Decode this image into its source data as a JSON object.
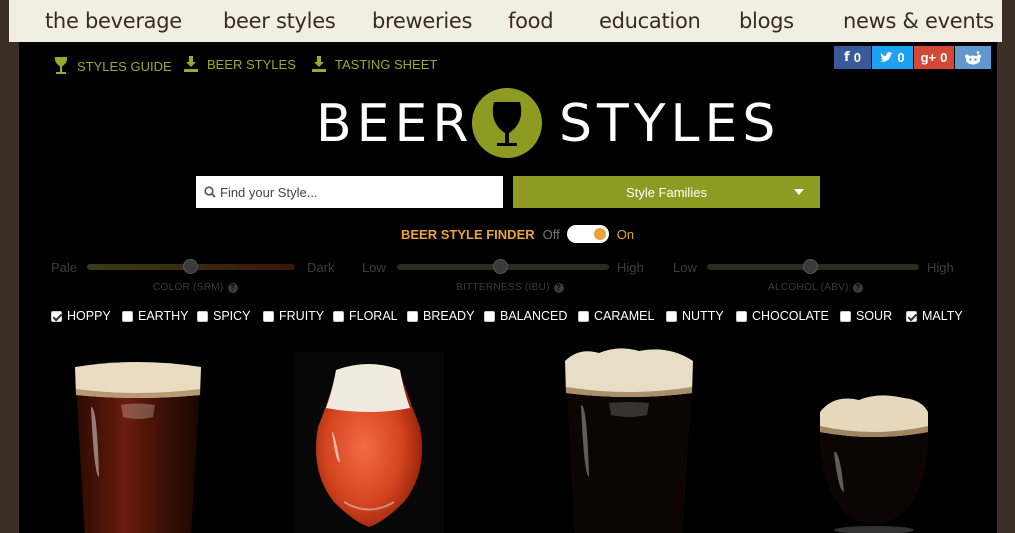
{
  "nav": {
    "items": [
      "the beverage",
      "beer styles",
      "breweries",
      "food",
      "education",
      "blogs",
      "news & events"
    ]
  },
  "toolbar": {
    "styles_guide": "STYLES GUIDE",
    "beer_styles": "BEER STYLES",
    "tasting_sheet": "TASTING SHEET"
  },
  "social": {
    "facebook": {
      "count": "0",
      "color": "#3b5998"
    },
    "twitter": {
      "count": "0",
      "color": "#1da1f2"
    },
    "googleplus": {
      "count": "0",
      "color": "#d34836"
    },
    "reddit": {
      "count": "",
      "color": "#5f99cf"
    }
  },
  "logo": {
    "left": "BEER",
    "right": "STYLES"
  },
  "search": {
    "placeholder": "Find your Style..."
  },
  "families": {
    "label": "Style Families"
  },
  "finder": {
    "label": "BEER STYLE FINDER",
    "off": "Off",
    "on": "On",
    "state": "on"
  },
  "sliders": [
    {
      "min_label": "Pale",
      "max_label": "Dark",
      "caption": "COLOR (SRM)",
      "value": 0.5
    },
    {
      "min_label": "Low",
      "max_label": "High",
      "caption": "BITTERNESS (IBU)",
      "value": 0.5
    },
    {
      "min_label": "Low",
      "max_label": "High",
      "caption": "ALCOHOL (ABV)",
      "value": 0.5
    }
  ],
  "flavors": [
    {
      "label": "HOPPY",
      "checked": true
    },
    {
      "label": "EARTHY",
      "checked": false
    },
    {
      "label": "SPICY",
      "checked": false
    },
    {
      "label": "FRUITY",
      "checked": false
    },
    {
      "label": "FLORAL",
      "checked": false
    },
    {
      "label": "BREADY",
      "checked": false
    },
    {
      "label": "BALANCED",
      "checked": false
    },
    {
      "label": "CARAMEL",
      "checked": false
    },
    {
      "label": "NUTTY",
      "checked": false
    },
    {
      "label": "CHOCOLATE",
      "checked": false
    },
    {
      "label": "SOUR",
      "checked": false
    },
    {
      "label": "MALTY",
      "checked": true
    }
  ],
  "colors": {
    "accent": "#8e9b22",
    "orange": "#e8a23a",
    "nav_bg": "#f1eee4",
    "frame": "#3b2f27"
  }
}
